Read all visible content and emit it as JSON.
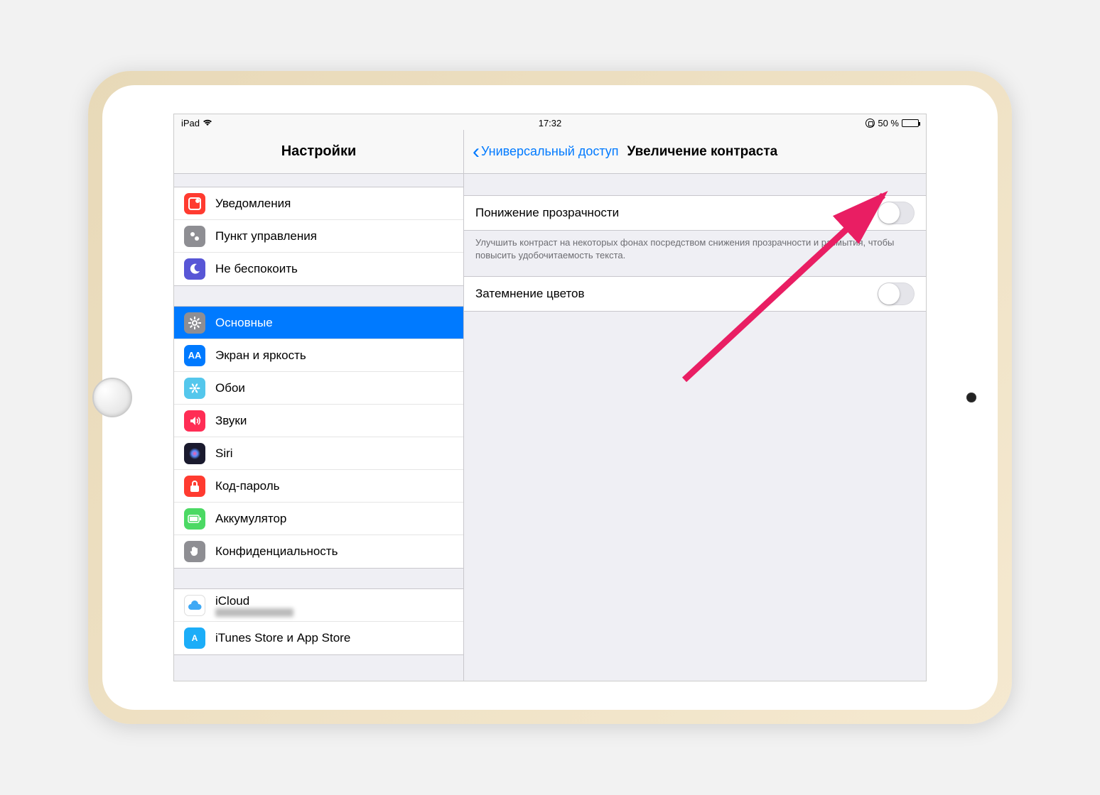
{
  "statusbar": {
    "carrier": "iPad",
    "time": "17:32",
    "battery_pct": "50 %"
  },
  "sidebar": {
    "title": "Настройки",
    "group1": [
      {
        "label": "Уведомления",
        "icon_bg": "#ff3b30",
        "icon": "notif"
      },
      {
        "label": "Пункт управления",
        "icon_bg": "#8e8e93",
        "icon": "control"
      },
      {
        "label": "Не беспокоить",
        "icon_bg": "#5856d6",
        "icon": "moon"
      }
    ],
    "group2": [
      {
        "label": "Основные",
        "icon_bg": "#8e8e93",
        "icon": "gear",
        "selected": true
      },
      {
        "label": "Экран и яркость",
        "icon_bg": "#007aff",
        "icon": "aa"
      },
      {
        "label": "Обои",
        "icon_bg": "#54c7ec",
        "icon": "flower"
      },
      {
        "label": "Звуки",
        "icon_bg": "#ff2d55",
        "icon": "sound"
      },
      {
        "label": "Siri",
        "icon_bg": "#1a1a2e",
        "icon": "siri"
      },
      {
        "label": "Код-пароль",
        "icon_bg": "#ff3b30",
        "icon": "lock"
      },
      {
        "label": "Аккумулятор",
        "icon_bg": "#4cd964",
        "icon": "batt"
      },
      {
        "label": "Конфиденциальность",
        "icon_bg": "#8e8e93",
        "icon": "hand"
      }
    ],
    "group3": [
      {
        "label": "iCloud",
        "icon_bg": "#ffffff",
        "icon": "cloud",
        "sub_blur": true
      },
      {
        "label": "iTunes Store и App Store",
        "icon_bg": "#1badf8",
        "icon": "appstore"
      }
    ]
  },
  "detail": {
    "back_label": "Универсальный доступ",
    "title": "Увеличение контраста",
    "row1_label": "Понижение прозрачности",
    "row1_note": "Улучшить контраст на некоторых фонах посредством снижения прозрачности и размытия, чтобы повысить удобочитаемость текста.",
    "row2_label": "Затемнение цветов"
  }
}
